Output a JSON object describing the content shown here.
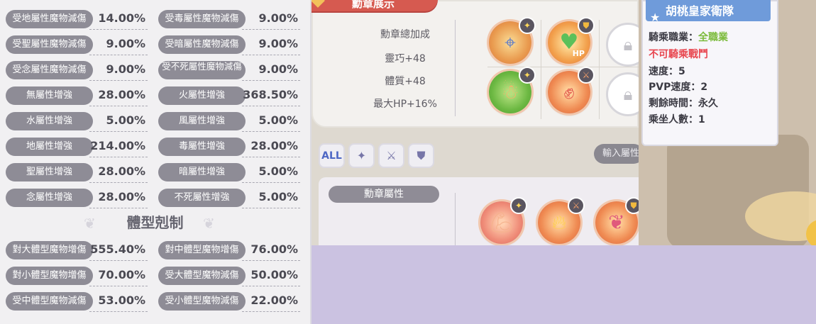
{
  "stats_rows": [
    [
      {
        "label": "受地屬性魔物減傷",
        "value": "14.00%"
      },
      {
        "label": "受毒屬性魔物減傷",
        "value": "9.00%"
      }
    ],
    [
      {
        "label": "受聖屬性魔物減傷",
        "value": "9.00%"
      },
      {
        "label": "受暗屬性魔物減傷",
        "value": "9.00%"
      }
    ],
    [
      {
        "label": "受念屬性魔物減傷",
        "value": "9.00%"
      },
      {
        "label": "受不死屬性魔物減傷",
        "value": "9.00%"
      }
    ],
    [
      {
        "label": "無屬性增強",
        "value": "28.00%"
      },
      {
        "label": "火屬性增強",
        "value": "368.50%"
      }
    ],
    [
      {
        "label": "水屬性增強",
        "value": "5.00%"
      },
      {
        "label": "風屬性增強",
        "value": "5.00%"
      }
    ],
    [
      {
        "label": "地屬性增強",
        "value": "214.00%"
      },
      {
        "label": "毒屬性增強",
        "value": "28.00%"
      }
    ],
    [
      {
        "label": "聖屬性增強",
        "value": "28.00%"
      },
      {
        "label": "暗屬性增強",
        "value": "5.00%"
      }
    ],
    [
      {
        "label": "念屬性增強",
        "value": "28.00%"
      },
      {
        "label": "不死屬性增強",
        "value": "5.00%"
      }
    ]
  ],
  "section_title": "體型剋制",
  "size_rows": [
    [
      {
        "label": "對大體型魔物增傷",
        "value": "555.40%"
      },
      {
        "label": "對中體型魔物增傷",
        "value": "76.00%"
      }
    ],
    [
      {
        "label": "對小體型魔物增傷",
        "value": "70.00%"
      },
      {
        "label": "受大體型魔物減傷",
        "value": "50.00%"
      }
    ],
    [
      {
        "label": "受中體型魔物減傷",
        "value": "53.00%"
      },
      {
        "label": "受小體型魔物減傷",
        "value": "22.00%"
      }
    ]
  ],
  "medal_panel": {
    "tab_title": "勳章展示",
    "bonus_title": "勳章總加成",
    "bonuses": [
      "靈巧+48",
      "體質+48",
      "最大HP+16%"
    ],
    "hp_label": "HP"
  },
  "filter": {
    "all_label": "ALL",
    "search_placeholder": "輸入屬性"
  },
  "medal_attr_label": "勳章屬性",
  "mount_card": {
    "title": "胡桃皇家衛隊",
    "job_label": "騎乘職業：",
    "job_value": "全職業",
    "no_battle": "不可騎乘戰鬥",
    "speed": "速度：5",
    "pvp_speed": "PVP速度：2",
    "remaining": "剩餘時間：永久",
    "riders": "乘坐人數：1"
  },
  "colors": {
    "pill": "#8e8c96",
    "accent_red": "#d65a50",
    "card_blue": "#6f9bda",
    "green": "#7cbb3c",
    "red_text": "#e8464f",
    "filler": "#cbc2e1"
  }
}
